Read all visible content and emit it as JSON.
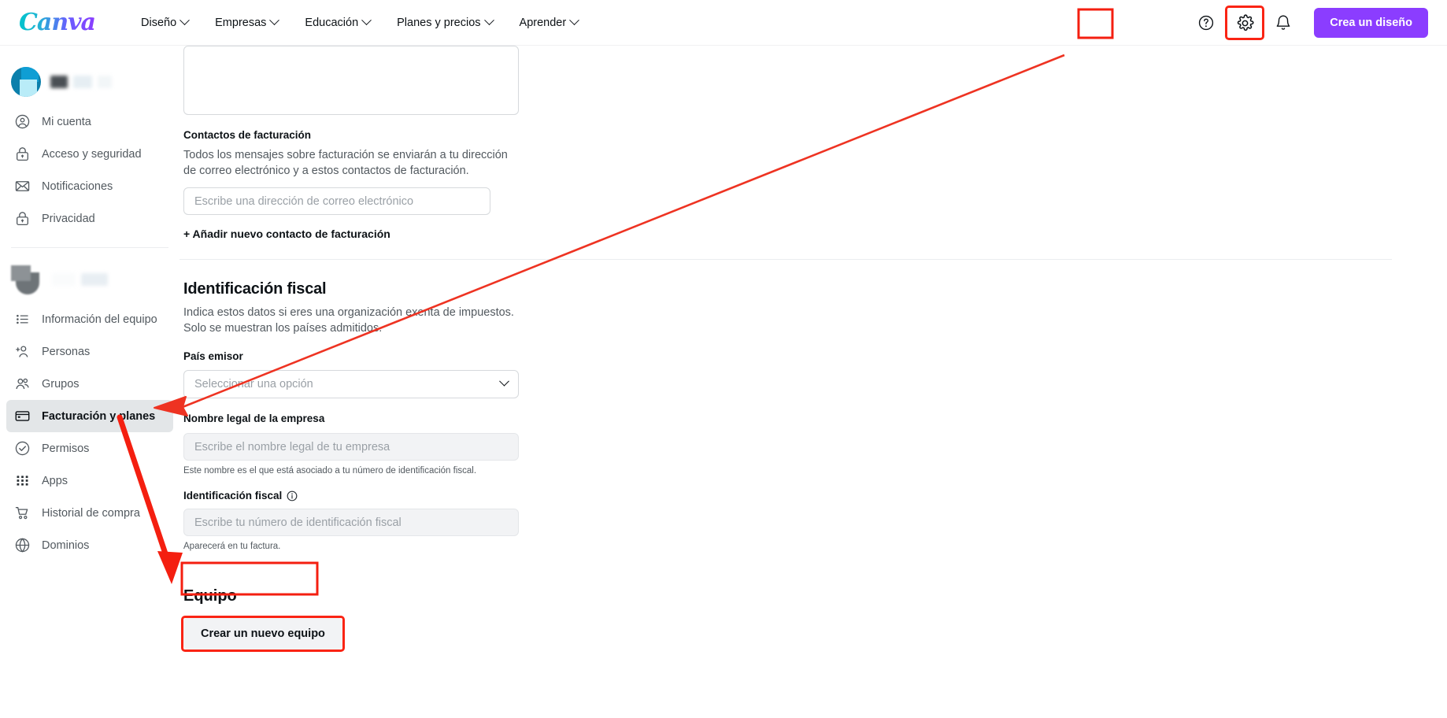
{
  "header": {
    "logo_text": "Canva",
    "nav": [
      {
        "label": "Diseño",
        "icon": "chevron-down-icon"
      },
      {
        "label": "Empresas",
        "icon": "chevron-down-icon"
      },
      {
        "label": "Educación",
        "icon": "chevron-down-icon"
      },
      {
        "label": "Planes y precios",
        "icon": "chevron-down-icon"
      },
      {
        "label": "Aprender",
        "icon": "chevron-down-icon"
      }
    ],
    "help_icon": "help-circle-icon",
    "settings_icon": "gear-icon",
    "notifications_icon": "bell-icon",
    "cta_label": "Crea un diseño",
    "cta_color": "#8b3dff"
  },
  "sidebar": {
    "account_section": [
      {
        "label": "Mi cuenta",
        "icon": "user-circle-icon"
      },
      {
        "label": "Acceso y seguridad",
        "icon": "lock-icon"
      },
      {
        "label": "Notificaciones",
        "icon": "envelope-icon"
      },
      {
        "label": "Privacidad",
        "icon": "lock-icon"
      }
    ],
    "team_section": [
      {
        "label": "Información del equipo",
        "icon": "list-icon"
      },
      {
        "label": "Personas",
        "icon": "add-person-icon"
      },
      {
        "label": "Grupos",
        "icon": "people-icon"
      },
      {
        "label": "Facturación y planes",
        "icon": "credit-card-icon",
        "active": true
      },
      {
        "label": "Permisos",
        "icon": "check-circle-icon"
      },
      {
        "label": "Apps",
        "icon": "grid-dots-icon"
      },
      {
        "label": "Historial de compra",
        "icon": "shopping-cart-icon"
      },
      {
        "label": "Dominios",
        "icon": "globe-icon"
      }
    ]
  },
  "main": {
    "billing_contacts": {
      "label": "Contactos de facturación",
      "description": "Todos los mensajes sobre facturación se enviarán a tu dirección de correo electrónico y a estos contactos de facturación.",
      "email_placeholder": "Escribe una dirección de correo electrónico",
      "email_value": "",
      "add_link": "+ Añadir nuevo contacto de facturación"
    },
    "tax_section": {
      "heading": "Identificación fiscal",
      "description": "Indica estos datos si eres una organización exenta de impuestos. Solo se muestran los países admitidos.",
      "country_label": "País emisor",
      "country_placeholder": "Seleccionar una opción",
      "country_value": "",
      "company_label": "Nombre legal de la empresa",
      "company_placeholder": "Escribe el nombre legal de tu empresa",
      "company_value": "",
      "company_help": "Este nombre es el que está asociado a tu número de identificación fiscal.",
      "taxid_label": "Identificación fiscal",
      "taxid_info_icon": "info-icon",
      "taxid_placeholder": "Escribe tu número de identificación fiscal",
      "taxid_value": "",
      "taxid_help": "Aparecerá en tu factura."
    },
    "team_section": {
      "heading": "Equipo",
      "create_button": "Crear un nuevo equipo"
    }
  },
  "annotations": {
    "highlight_color": "#fa2414",
    "arrow_from": "settings-gear-icon",
    "arrow_to": "sidebar-item-facturacion-y-planes",
    "second_arrow_to": "create-team-button"
  }
}
